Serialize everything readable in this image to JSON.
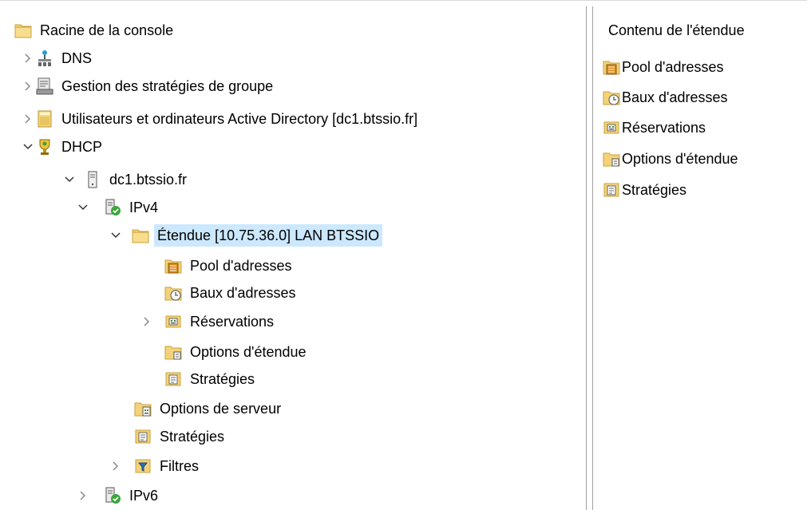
{
  "tree": {
    "root": "Racine de la console",
    "dns": "DNS",
    "gpo": "Gestion des stratégies de groupe",
    "ad": "Utilisateurs et ordinateurs Active Directory [dc1.btssio.fr]",
    "dhcp": "DHCP",
    "server": "dc1.btssio.fr",
    "ipv4": "IPv4",
    "scope": "Étendue [10.75.36.0] LAN BTSSIO",
    "pool": "Pool d'adresses",
    "leases": "Baux d'adresses",
    "reservations": "Réservations",
    "scope_options": "Options d'étendue",
    "scope_policies": "Stratégies",
    "server_options": "Options de serveur",
    "policies": "Stratégies",
    "filters": "Filtres",
    "ipv6": "IPv6"
  },
  "content": {
    "title": "Contenu de l'étendue",
    "items": [
      "Pool d'adresses",
      "Baux d'adresses",
      "Réservations",
      "Options d'étendue",
      "Stratégies"
    ]
  },
  "colors": {
    "selection": "#cce8ff",
    "folder": "#f3d27a",
    "folder_edge": "#c9a33a",
    "check": "#3aa83a"
  }
}
